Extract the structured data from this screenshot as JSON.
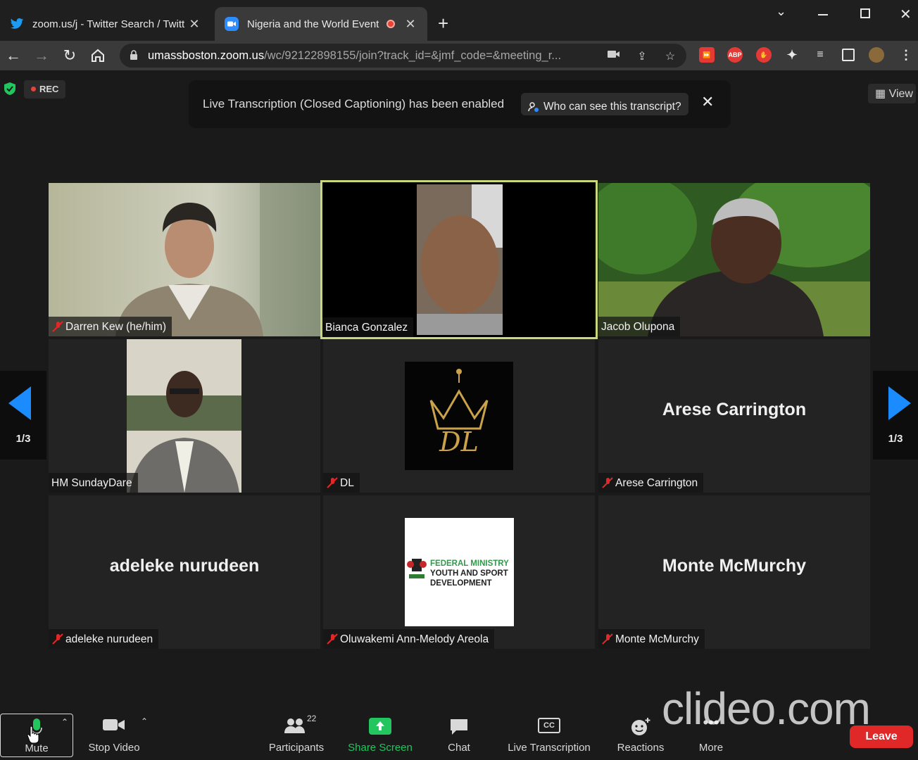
{
  "browser": {
    "tabs": [
      {
        "title": "zoom.us/j - Twitter Search / Twitt",
        "icon": "twitter-icon",
        "active": false
      },
      {
        "title": "Nigeria and the World Event",
        "icon": "zoom-icon",
        "active": true,
        "recording": true
      }
    ],
    "new_tab": "+",
    "url": {
      "host": "umassboston.zoom.us",
      "path": "/wc/92122898155/join?track_id=&jmf_code=&meeting_r..."
    },
    "extensions": [
      "ABP"
    ]
  },
  "zoom": {
    "rec_label": "REC",
    "view_label": "View",
    "banner": {
      "message": "Live Transcription (Closed Captioning) has been enabled",
      "who_button": "Who can see this transcript?"
    },
    "pager": {
      "left": "1/3",
      "right": "1/3"
    },
    "tiles": [
      {
        "name": "Darren Kew (he/him)",
        "muted": true,
        "type": "video"
      },
      {
        "name": "Bianca Gonzalez",
        "muted": false,
        "type": "video",
        "active_speaker": true
      },
      {
        "name": "Jacob Olupona",
        "muted": false,
        "type": "video"
      },
      {
        "name": "HM SundayDare",
        "muted": false,
        "type": "video"
      },
      {
        "name": "DL",
        "muted": true,
        "type": "avatar",
        "avatar_text": "DL"
      },
      {
        "name": "Arese Carrington",
        "muted": true,
        "type": "name",
        "display": "Arese Carrington"
      },
      {
        "name": "adeleke nurudeen",
        "muted": true,
        "type": "name",
        "display": "adeleke nurudeen"
      },
      {
        "name": "Oluwakemi Ann-Melody Areola",
        "muted": true,
        "type": "logo",
        "logo_text": [
          "FEDERAL MINISTRY",
          "YOUTH AND SPORT",
          "DEVELOPMENT"
        ]
      },
      {
        "name": "Monte McMurchy",
        "muted": true,
        "type": "name",
        "display": "Monte McMurchy"
      }
    ],
    "controls": {
      "mute": "Mute",
      "stop_video": "Stop Video",
      "participants": "Participants",
      "participants_count": "22",
      "share_screen": "Share Screen",
      "chat": "Chat",
      "live_transcription": "Live Transcription",
      "cc_icon_text": "CC",
      "reactions": "Reactions",
      "more": "More",
      "leave": "Leave"
    },
    "watermark": "clideo.com"
  },
  "colors": {
    "accent_green": "#22c55e",
    "leave_red": "#e02828",
    "speaker_outline": "#cad77c",
    "pager_blue": "#1a8cff"
  }
}
